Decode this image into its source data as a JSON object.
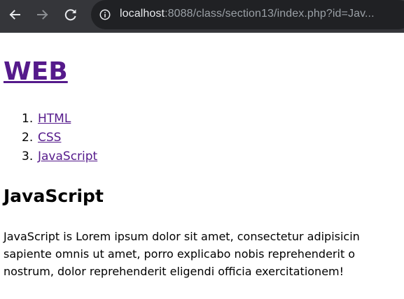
{
  "browser": {
    "url_host": "localhost",
    "url_rest": ":8088/class/section13/index.php?id=Jav..."
  },
  "page": {
    "site_title": "WEB",
    "nav": [
      {
        "number": "1.",
        "label": "HTML"
      },
      {
        "number": "2.",
        "label": "CSS"
      },
      {
        "number": "3.",
        "label": "JavaScript"
      }
    ],
    "heading": "JavaScript",
    "body_lines": [
      "JavaScript is Lorem ipsum dolor sit amet, consectetur adipisicin",
      "sapiente omnis ut amet, porro explicabo nobis reprehenderit o",
      "nostrum, dolor reprehenderit eligendi officia exercitationem!"
    ]
  },
  "colors": {
    "toolbar_bg": "#35363a",
    "omnibox_bg": "#202124",
    "visited_link": "#551a8b"
  }
}
